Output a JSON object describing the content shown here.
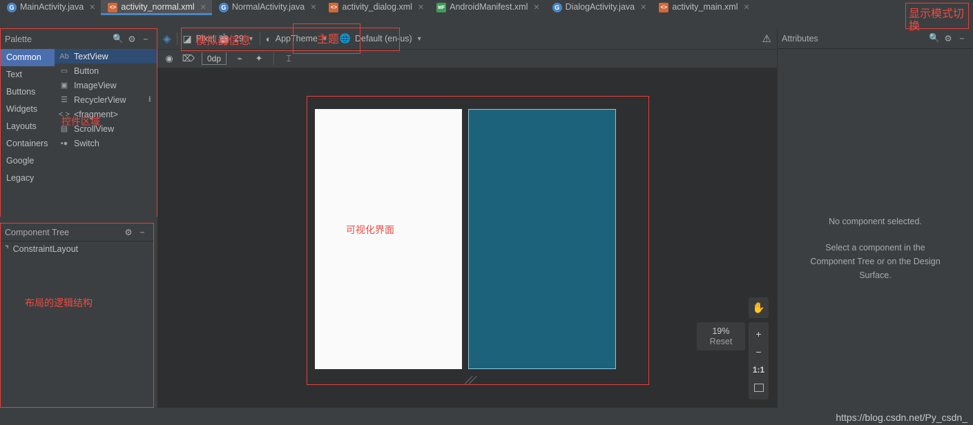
{
  "tabs": [
    {
      "label": "MainActivity.java",
      "icon": "java-class-icon",
      "type": "java",
      "active": false
    },
    {
      "label": "activity_normal.xml",
      "icon": "xml-file-icon",
      "type": "xml",
      "active": true
    },
    {
      "label": "NormalActivity.java",
      "icon": "java-class-icon",
      "type": "java",
      "active": false
    },
    {
      "label": "activity_dialog.xml",
      "icon": "xml-file-icon",
      "type": "xml",
      "active": false
    },
    {
      "label": "AndroidManifest.xml",
      "icon": "manifest-icon",
      "type": "mf",
      "active": false
    },
    {
      "label": "DialogActivity.java",
      "icon": "java-class-icon",
      "type": "java",
      "active": false
    },
    {
      "label": "activity_main.xml",
      "icon": "xml-file-icon",
      "type": "xml",
      "active": false
    }
  ],
  "palette": {
    "title": "Palette",
    "search_icon": "search-icon",
    "settings_icon": "gear-icon",
    "minimize_icon": "minimize-icon",
    "categories": [
      {
        "label": "Common",
        "selected": true
      },
      {
        "label": "Text",
        "selected": false
      },
      {
        "label": "Buttons",
        "selected": false
      },
      {
        "label": "Widgets",
        "selected": false
      },
      {
        "label": "Layouts",
        "selected": false
      },
      {
        "label": "Containers",
        "selected": false
      },
      {
        "label": "Google",
        "selected": false
      },
      {
        "label": "Legacy",
        "selected": false
      }
    ],
    "items": [
      {
        "label": "TextView",
        "glyph": "Ab",
        "selected": true,
        "download": false
      },
      {
        "label": "Button",
        "glyph": "▭",
        "selected": false,
        "download": false
      },
      {
        "label": "ImageView",
        "glyph": "▣",
        "selected": false,
        "download": false
      },
      {
        "label": "RecyclerView",
        "glyph": "☰",
        "selected": false,
        "download": true
      },
      {
        "label": "<fragment>",
        "glyph": "< >",
        "selected": false,
        "download": false
      },
      {
        "label": "ScrollView",
        "glyph": "▤",
        "selected": false,
        "download": false
      },
      {
        "label": "Switch",
        "glyph": "•●",
        "selected": false,
        "download": false
      }
    ],
    "annotation": "控件区域"
  },
  "component_tree": {
    "title": "Component Tree",
    "settings_icon": "gear-icon",
    "minimize_icon": "minimize-icon",
    "nodes": [
      {
        "label": "ConstraintLayout",
        "icon": "constraint-layout-icon"
      }
    ],
    "annotation": "布局的逻辑结构"
  },
  "toolbar": {
    "view_mode_icon": "layers-icon",
    "device_icon": "device-screen-icon",
    "device_label": "Pixel",
    "api_icon": "android-robot-icon",
    "api_level": "29",
    "theme_icon": "theme-circle-icon",
    "theme_label": "AppTheme",
    "locale_icon": "globe-icon",
    "locale_label": "Default (en-us)",
    "warning_icon": "warning-icon",
    "annotations": {
      "emulator_info": "模拟器信息",
      "theme": "主题",
      "display_mode": "显示模式切换"
    }
  },
  "toolbar2": {
    "buttons": [
      {
        "name": "show-constraints-icon",
        "glyph": "◉"
      },
      {
        "name": "autoconnect-icon",
        "glyph": "⌦"
      },
      {
        "name": "clear-constraints-icon",
        "glyph": "⌁"
      },
      {
        "name": "infer-constraints-icon",
        "glyph": "✦"
      },
      {
        "name": "margin-guideline-icon",
        "glyph": "⌶"
      }
    ],
    "default_margin": "0dp"
  },
  "surface": {
    "annotation": "可视化界面",
    "design_view_name": "design-preview",
    "blueprint_view_name": "blueprint-preview",
    "blueprint_color": "#1d627b"
  },
  "zoom_controls": {
    "pan_icon": "pan-hand-icon",
    "percent": "19%",
    "reset_label": "Reset",
    "zoom_in": "+",
    "zoom_out": "−",
    "actual_size": "1:1",
    "zoom_to_fit_icon": "zoom-to-fit-icon"
  },
  "attributes": {
    "title": "Attributes",
    "search_icon": "search-icon",
    "settings_icon": "gear-icon",
    "minimize_icon": "minimize-icon",
    "empty_title": "No component selected.",
    "empty_body_line1": "Select a component in the",
    "empty_body_line2": "Component Tree or on the Design",
    "empty_body_line3": "Surface."
  },
  "watermark": "https://blog.csdn.net/Py_csdn_",
  "colors": {
    "accent_red": "#e8413a",
    "selection_blue": "#4b6eaf",
    "tab_underline": "#4a88c7",
    "panel_bg": "#3c3f41",
    "surface_bg": "#2d2f31"
  }
}
